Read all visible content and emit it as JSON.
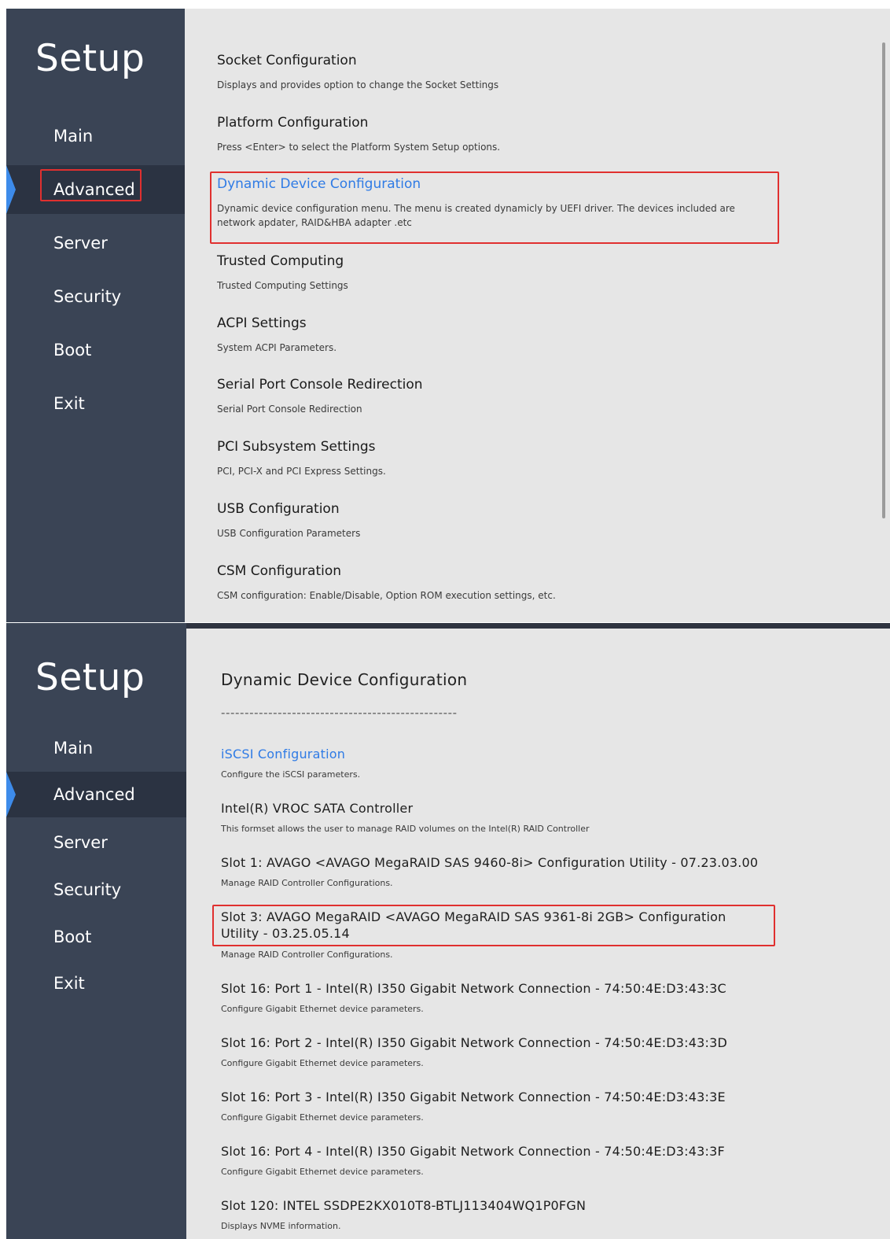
{
  "top": {
    "sidebar": {
      "title": "Setup",
      "items": [
        {
          "label": "Main"
        },
        {
          "label": "Advanced"
        },
        {
          "label": "Server"
        },
        {
          "label": "Security"
        },
        {
          "label": "Boot"
        },
        {
          "label": "Exit"
        }
      ]
    },
    "entries": [
      {
        "title": "Socket Configuration",
        "desc": "Displays and provides option to change the Socket Settings"
      },
      {
        "title": "Platform Configuration",
        "desc": "Press <Enter> to select the Platform System Setup options."
      },
      {
        "title": "Dynamic Device Configuration",
        "desc": "Dynamic device configuration menu. The menu is created dynamicly by UEFI driver. The devices included are",
        "desc2": "network apdater, RAID&HBA adapter .etc"
      },
      {
        "title": "Trusted Computing",
        "desc": "Trusted Computing Settings"
      },
      {
        "title": "ACPI Settings",
        "desc": "System ACPI Parameters."
      },
      {
        "title": "Serial Port Console Redirection",
        "desc": "Serial Port Console Redirection"
      },
      {
        "title": "PCI Subsystem Settings",
        "desc": "PCI, PCI-X and PCI Express Settings."
      },
      {
        "title": "USB Configuration",
        "desc": "USB Configuration Parameters"
      },
      {
        "title": "CSM Configuration",
        "desc": "CSM configuration: Enable/Disable, Option ROM execution settings, etc."
      }
    ]
  },
  "bottom": {
    "sidebar": {
      "title": "Setup",
      "items": [
        {
          "label": "Main"
        },
        {
          "label": "Advanced"
        },
        {
          "label": "Server"
        },
        {
          "label": "Security"
        },
        {
          "label": "Boot"
        },
        {
          "label": "Exit"
        }
      ]
    },
    "heading": "Dynamic Device Configuration",
    "separator": "--------------------------------------------------",
    "entries": [
      {
        "title": "iSCSI Configuration",
        "desc": "Configure the iSCSI parameters."
      },
      {
        "title": "Intel(R) VROC SATA Controller",
        "desc": "This formset allows the user to manage RAID volumes on the Intel(R) RAID Controller"
      },
      {
        "title": "Slot 1: AVAGO <AVAGO MegaRAID SAS 9460-8i> Configuration Utility - 07.23.03.00",
        "desc": "Manage RAID Controller Configurations."
      },
      {
        "title": "Slot 3: AVAGO MegaRAID <AVAGO MegaRAID SAS 9361-8i 2GB> Configuration",
        "title2": "Utility - 03.25.05.14",
        "desc": "Manage RAID Controller Configurations."
      },
      {
        "title": "Slot 16: Port 1 - Intel(R) I350 Gigabit Network Connection - 74:50:4E:D3:43:3C",
        "desc": "Configure Gigabit Ethernet device parameters."
      },
      {
        "title": "Slot 16: Port 2 - Intel(R) I350 Gigabit Network Connection - 74:50:4E:D3:43:3D",
        "desc": "Configure Gigabit Ethernet device parameters."
      },
      {
        "title": "Slot 16: Port 3 - Intel(R) I350 Gigabit Network Connection - 74:50:4E:D3:43:3E",
        "desc": "Configure Gigabit Ethernet device parameters."
      },
      {
        "title": "Slot 16: Port 4 - Intel(R) I350 Gigabit Network Connection - 74:50:4E:D3:43:3F",
        "desc": "Configure Gigabit Ethernet device parameters."
      },
      {
        "title": "Slot 120: INTEL SSDPE2KX010T8-BTLJ113404WQ1P0FGN",
        "desc": "Displays NVME information."
      }
    ]
  },
  "colors": {
    "sidebar_bg": "#3a4455",
    "active_bg": "#2b3342",
    "accent": "#3d8bea",
    "link": "#2f7be5",
    "highlight": "#e0302f",
    "content_bg": "#e6e6e6"
  }
}
